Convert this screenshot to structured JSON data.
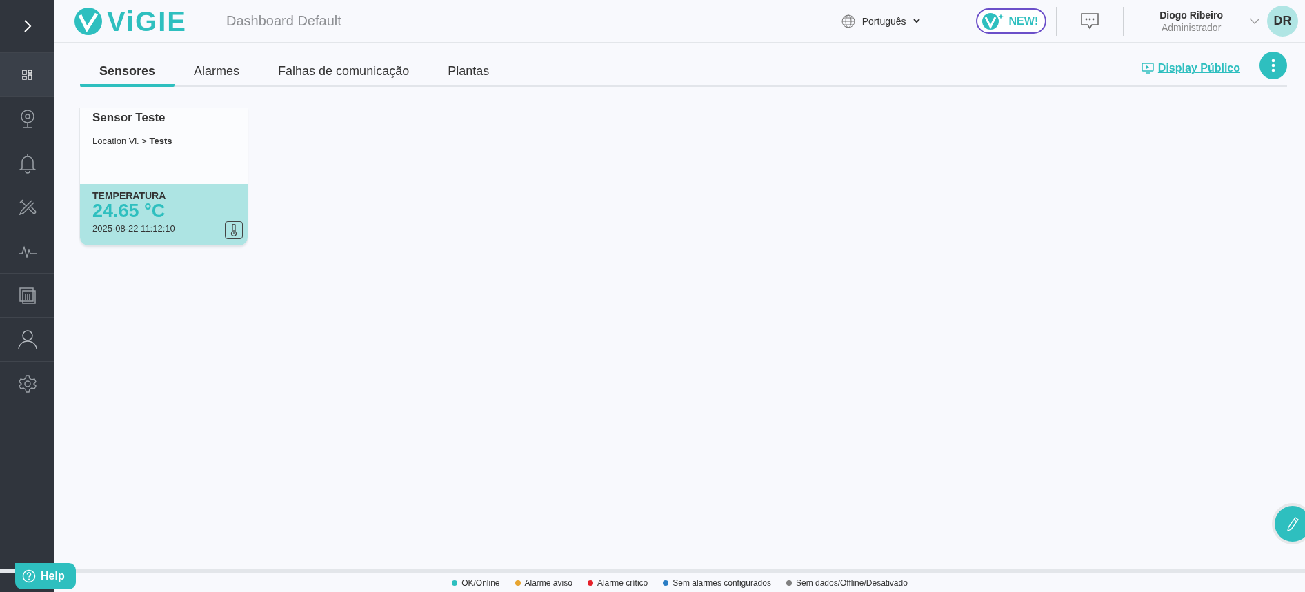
{
  "sidebar": {
    "items": [
      {
        "kind": "dashboard",
        "selected": true
      },
      {
        "kind": "sensor",
        "selected": false
      },
      {
        "kind": "bell",
        "selected": false
      },
      {
        "kind": "tools",
        "selected": false
      },
      {
        "kind": "pulse",
        "selected": false
      },
      {
        "kind": "columns",
        "selected": false
      },
      {
        "kind": "user",
        "selected": false
      },
      {
        "kind": "gear",
        "selected": false
      }
    ]
  },
  "header": {
    "logo": "ViGIE",
    "title": "Dashboard Default",
    "language": "Português",
    "new_badge": "NEW!",
    "user": {
      "name": "Diogo Ribeiro",
      "role": "Administrador",
      "initials": "DR"
    }
  },
  "tabs": [
    {
      "label": "Sensores",
      "selected": true
    },
    {
      "label": "Alarmes",
      "selected": false
    },
    {
      "label": "Falhas de comunicação",
      "selected": false
    },
    {
      "label": "Plantas",
      "selected": false
    }
  ],
  "display_link": "Display Público",
  "cards": [
    {
      "name": "Sensor Teste",
      "location": "Location Vi. > **Tests**",
      "measure": "TEMPERATURA",
      "value": "24.65 °C",
      "time": "2025-08-22 11:12:10",
      "color": "#ade4e3"
    }
  ],
  "help": "Help",
  "legend": [
    {
      "label": "OK/Online",
      "color": "#2ebfbf"
    },
    {
      "label": "Alarme aviso",
      "color": "#e8a530"
    },
    {
      "label": "Alarme crítico",
      "color": "#e5202a"
    },
    {
      "label": "Sem alarmes configurados",
      "color": "#2a7dc4"
    },
    {
      "label": "Sem dados/Offline/Desativado",
      "color": "#808080"
    }
  ]
}
